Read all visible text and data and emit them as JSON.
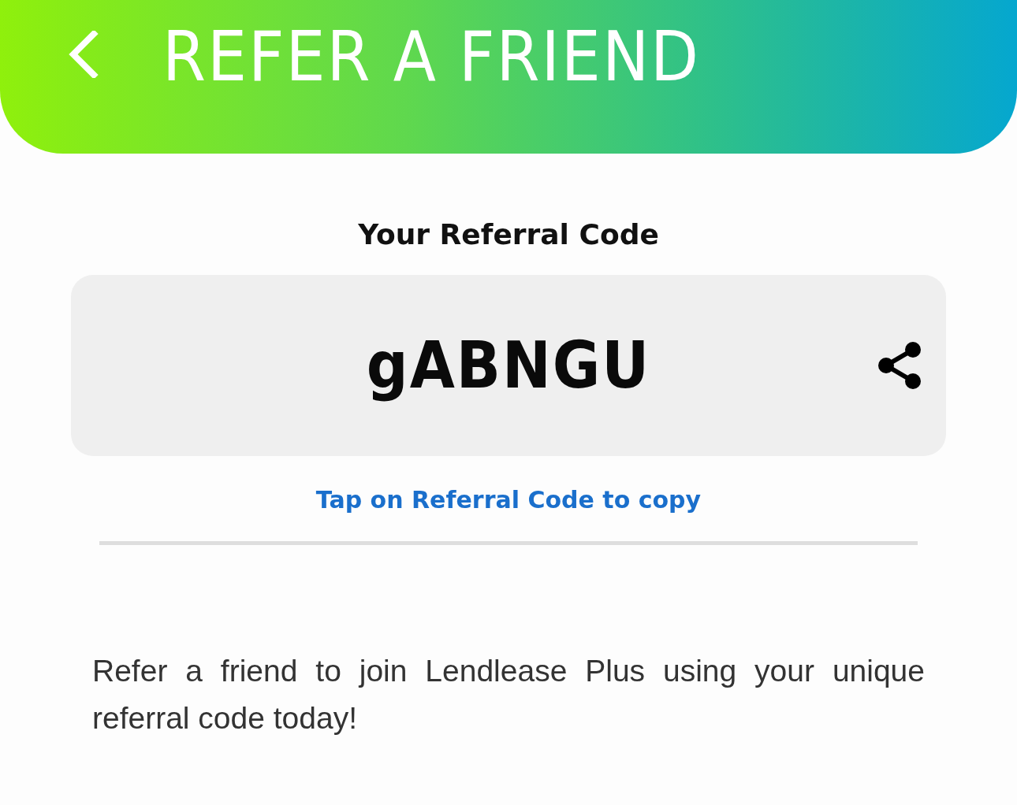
{
  "header": {
    "title": "REFER A FRIEND"
  },
  "referral": {
    "heading": "Your Referral Code",
    "code": "gABNGU",
    "copy_hint": "Tap on Referral Code to copy"
  },
  "description": "Refer a friend to join Lendlease Plus using your unique referral code today!"
}
